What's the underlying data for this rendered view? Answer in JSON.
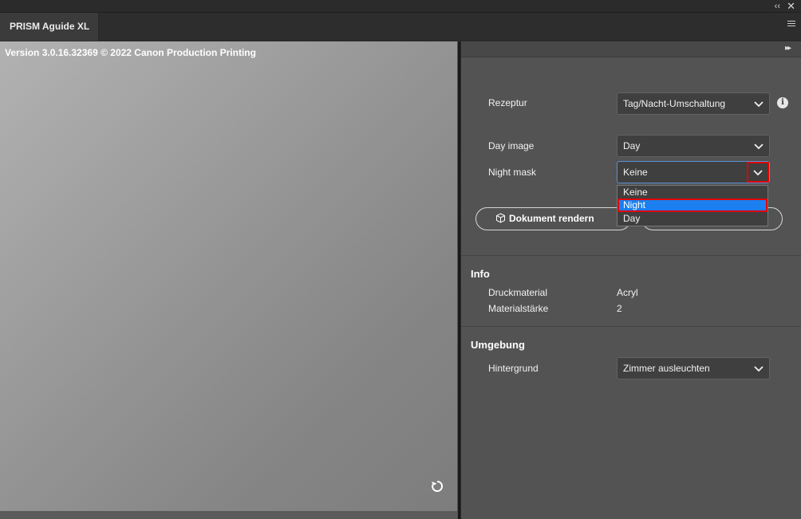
{
  "window": {
    "collapse_glyph": "‹‹",
    "close_glyph": "✕"
  },
  "tab": {
    "title": "PRISM Aguide XL"
  },
  "preview": {
    "version_text": "Version 3.0.16.32369 © 2022 Canon Production Printing"
  },
  "panel": {
    "expand_glyph": "▸▸",
    "recipe": {
      "label": "Rezeptur",
      "value": "Tag/Nacht-Umschaltung"
    },
    "day_image": {
      "label": "Day image",
      "value": "Day"
    },
    "night_mask": {
      "label": "Night mask",
      "value": "Keine",
      "options": [
        "Keine",
        "Night",
        "Day"
      ],
      "highlighted_option": "Night"
    },
    "render_button": {
      "label": "Dokument rendern"
    },
    "info": {
      "title": "Info",
      "rows": [
        {
          "key": "Druckmaterial",
          "value": "Acryl"
        },
        {
          "key": "Materialstärke",
          "value": "2"
        }
      ]
    },
    "environment": {
      "title": "Umgebung",
      "background": {
        "label": "Hintergrund",
        "value": "Zimmer ausleuchten"
      }
    }
  },
  "colors": {
    "panel_bg": "#535353",
    "selection_blue": "#1b7ff0",
    "highlight_red": "#e00000"
  }
}
